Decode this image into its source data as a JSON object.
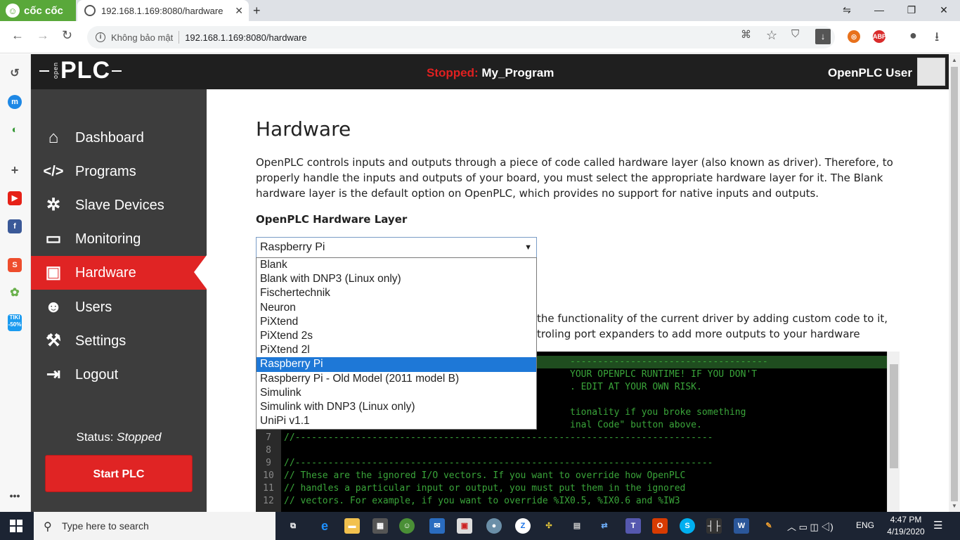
{
  "browser": {
    "brand": "cốc cốc",
    "tab_title": "192.168.1.169:8080/hardware",
    "security_label": "Không bảo mật",
    "url": "192.168.1.169:8080/hardware",
    "window_controls": [
      "minimize",
      "restore",
      "close"
    ]
  },
  "header": {
    "status_prefix": "Stopped:",
    "program_name": "My_Program",
    "user_name": "OpenPLC User"
  },
  "sidebar": {
    "items": [
      {
        "label": "Dashboard",
        "icon": "home-icon"
      },
      {
        "label": "Programs",
        "icon": "code-icon"
      },
      {
        "label": "Slave Devices",
        "icon": "network-icon"
      },
      {
        "label": "Monitoring",
        "icon": "monitor-icon"
      },
      {
        "label": "Hardware",
        "icon": "chip-icon",
        "active": true
      },
      {
        "label": "Users",
        "icon": "users-icon"
      },
      {
        "label": "Settings",
        "icon": "wrench-icon"
      },
      {
        "label": "Logout",
        "icon": "logout-icon"
      }
    ],
    "status_label": "Status:",
    "status_value": "Stopped",
    "start_button": "Start PLC"
  },
  "main": {
    "title": "Hardware",
    "description": "OpenPLC controls inputs and outputs through a piece of code called hardware layer (also known as driver). Therefore, to properly handle the inputs and outputs of your board, you must select the appropriate hardware layer for it. The Blank hardware layer is the default option on OpenPLC, which provides no support for native inputs and outputs.",
    "hw_layer_label": "OpenPLC Hardware Layer",
    "selected_layer": "Raspberry Pi",
    "layer_options": [
      "Blank",
      "Blank with DNP3 (Linux only)",
      "Fischertechnik",
      "Neuron",
      "PiXtend",
      "PiXtend 2s",
      "PiXtend 2l",
      "Raspberry Pi",
      "Raspberry Pi - Old Model (2011 model B)",
      "Simulink",
      "Simulink with DNP3 (Linux only)",
      "UniPi v1.1"
    ],
    "desc2_line1": "the functionality of the current driver by adding custom code to it,",
    "desc2_line2": "troling port expanders to add more outputs to your hardware"
  },
  "code_lines": [
    {
      "num": "",
      "text": "                                                    ------------------------------------"
    },
    {
      "num": "",
      "text": "                                                    YOUR OPENPLC RUNTIME! IF YOU DON'T"
    },
    {
      "num": "",
      "text": "                                                    . EDIT AT YOUR OWN RISK."
    },
    {
      "num": "",
      "text": ""
    },
    {
      "num": "",
      "text": "                                                    tionality if you broke something"
    },
    {
      "num": "",
      "text": "                                                    inal Code\" button above."
    },
    {
      "num": "7",
      "text": "//----------------------------------------------------------------------------"
    },
    {
      "num": "8",
      "text": ""
    },
    {
      "num": "9",
      "text": "//----------------------------------------------------------------------------"
    },
    {
      "num": "10",
      "text": "// These are the ignored I/O vectors. If you want to override how OpenPLC"
    },
    {
      "num": "11",
      "text": "// handles a particular input or output, you must put them in the ignored"
    },
    {
      "num": "12",
      "text": "// vectors. For example, if you want to override %IX0.5, %IX0.6 and %IW3"
    }
  ],
  "taskbar": {
    "search_placeholder": "Type here to search",
    "language": "ENG",
    "time": "4:47 PM",
    "date": "4/19/2020"
  }
}
